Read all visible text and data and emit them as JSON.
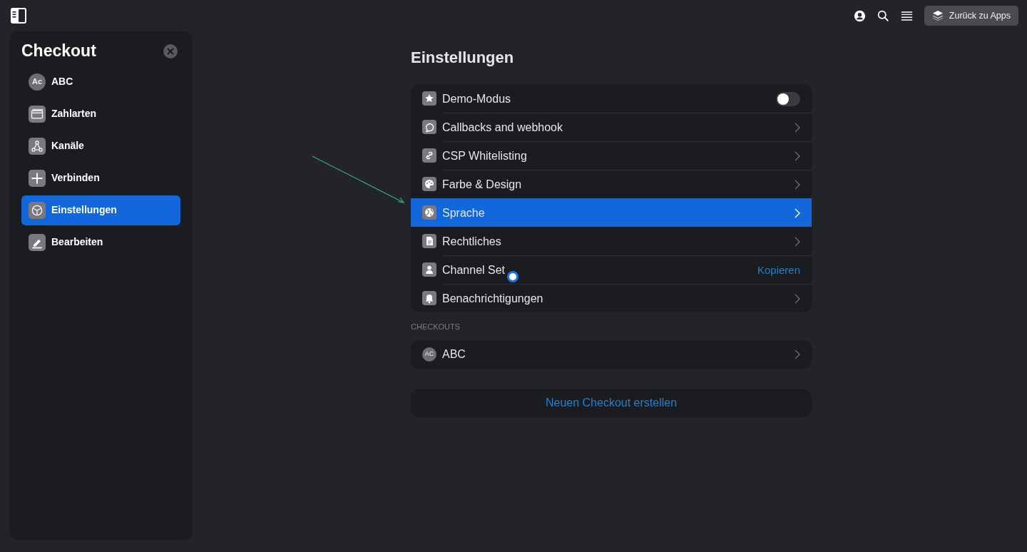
{
  "topbar": {
    "back_button": "Zurück zu Apps"
  },
  "sidebar": {
    "title": "Checkout",
    "items": [
      {
        "label": "ABC",
        "avatar": "Ac",
        "selected": false
      },
      {
        "label": "Zahlarten",
        "selected": false
      },
      {
        "label": "Kanäle",
        "selected": false
      },
      {
        "label": "Verbinden",
        "selected": false
      },
      {
        "label": "Einstellungen",
        "selected": true
      },
      {
        "label": "Bearbeiten",
        "selected": false
      }
    ]
  },
  "main": {
    "title": "Einstellungen",
    "settings": [
      {
        "kind": "toggle",
        "label": "Demo-Modus",
        "on": false,
        "selected": false
      },
      {
        "kind": "link",
        "label": "Callbacks and webhook",
        "selected": false
      },
      {
        "kind": "link",
        "label": "CSP Whitelisting",
        "selected": false
      },
      {
        "kind": "link",
        "label": "Farbe & Design",
        "selected": false
      },
      {
        "kind": "link",
        "label": "Sprache",
        "selected": true
      },
      {
        "kind": "link",
        "label": "Rechtliches",
        "selected": false
      },
      {
        "kind": "action",
        "label": "Channel Set",
        "action": "Kopieren",
        "selected": false
      },
      {
        "kind": "link",
        "label": "Benachrichtigungen",
        "selected": false
      }
    ],
    "checkouts_heading": "CHECKOUTS",
    "checkouts": [
      {
        "label": "ABC",
        "avatar": "AC"
      }
    ],
    "create_button": "Neuen Checkout erstellen"
  }
}
